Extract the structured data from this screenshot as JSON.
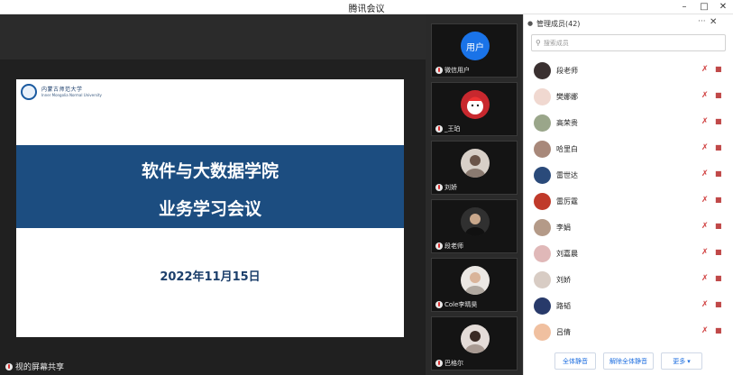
{
  "window": {
    "title": "腾讯会议",
    "minimize": "–",
    "maximize": "□",
    "close": "✕"
  },
  "slide": {
    "logo_text": "内蒙古师范大学",
    "logo_sub": "Inner Mongolia Normal University",
    "line1": "软件与大数据学院",
    "line2": "业务学习会议",
    "date": "2022年11月15日"
  },
  "share": {
    "label": "视的屏幕共享"
  },
  "videos": [
    {
      "name": "微信用户",
      "avatar_text": "用户",
      "avatar_color": "#1a73e8"
    },
    {
      "name": "_王珀",
      "avatar_text": "",
      "avatar_color": "#c8282e"
    },
    {
      "name": "刘娇",
      "avatar_text": "",
      "avatar_color": "#d8d0c8"
    },
    {
      "name": "段老师",
      "avatar_text": "",
      "avatar_color": "#303030"
    },
    {
      "name": "Cole李晴昊",
      "avatar_text": "",
      "avatar_color": "#ece8e4"
    },
    {
      "name": "巴格尔",
      "avatar_text": "",
      "avatar_color": "#e4dcd8"
    }
  ],
  "panel": {
    "title": "管理成员(42)",
    "more": "···",
    "close": "✕",
    "search_placeholder": "搜索成员",
    "members": [
      {
        "name": "段老师",
        "color": "#3a3030"
      },
      {
        "name": "樊娜娜",
        "color": "#f0d8d0"
      },
      {
        "name": "高荣贵",
        "color": "#9aa68a"
      },
      {
        "name": "哈里白",
        "color": "#a8887a"
      },
      {
        "name": "雷世达",
        "color": "#2a4a7a"
      },
      {
        "name": "雷厉霆",
        "color": "#c03a2a"
      },
      {
        "name": "李娟",
        "color": "#b49a88"
      },
      {
        "name": "刘嘉晨",
        "color": "#e0b8b8"
      },
      {
        "name": "刘娇",
        "color": "#d8ccc4"
      },
      {
        "name": "路韬",
        "color": "#283a6a"
      },
      {
        "name": "吕倩",
        "color": "#f0c0a0"
      }
    ],
    "mute_all": "全体静音",
    "unmute_all": "解除全体静音",
    "more_btn": "更多"
  }
}
